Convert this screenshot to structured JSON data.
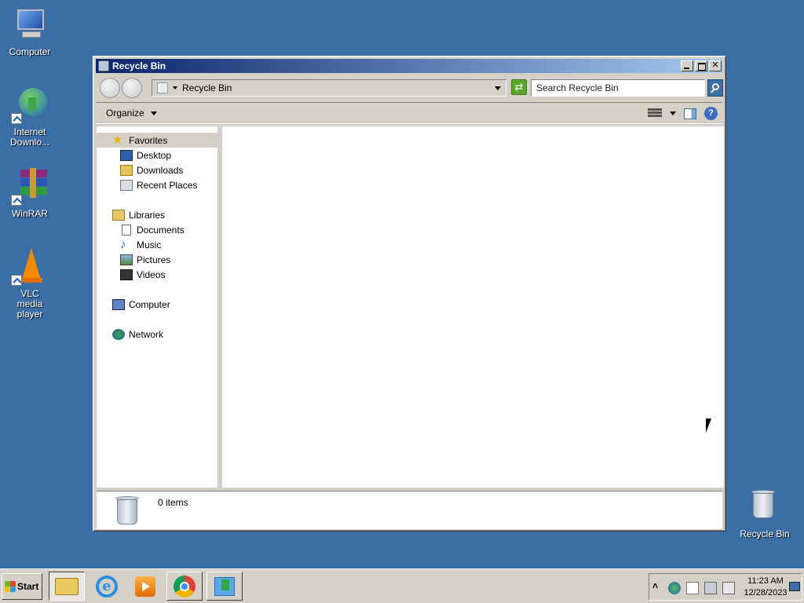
{
  "desktop": {
    "icons": [
      {
        "label": "Computer",
        "icon": "computer-icon"
      },
      {
        "label": "Internet Downlo...",
        "icon": "internet-download-manager-icon"
      },
      {
        "label": "WinRAR",
        "icon": "winrar-icon"
      },
      {
        "label": "VLC media player",
        "icon": "vlc-icon"
      },
      {
        "label": "Recycle Bin",
        "icon": "recycle-bin-icon"
      }
    ]
  },
  "window": {
    "title": "Recycle Bin",
    "address": "Recycle Bin",
    "search_placeholder": "Search Recycle Bin",
    "toolbar": {
      "organize_label": "Organize"
    },
    "nav": {
      "favorites": "Favorites",
      "favorites_items": [
        "Desktop",
        "Downloads",
        "Recent Places"
      ],
      "libraries": "Libraries",
      "libraries_items": [
        "Documents",
        "Music",
        "Pictures",
        "Videos"
      ],
      "computer": "Computer",
      "network": "Network"
    },
    "details": {
      "count": "0 items"
    }
  },
  "taskbar": {
    "start_label": "Start",
    "apps": [
      "windows-explorer",
      "internet-explorer",
      "windows-media-player",
      "google-chrome",
      "downloader"
    ],
    "clock_time": "11:23 AM",
    "clock_date": "12/28/2023"
  },
  "colors": {
    "desktop": "#3b6ea5",
    "titlebar_start": "#0a246a",
    "titlebar_end": "#a6caf0"
  }
}
